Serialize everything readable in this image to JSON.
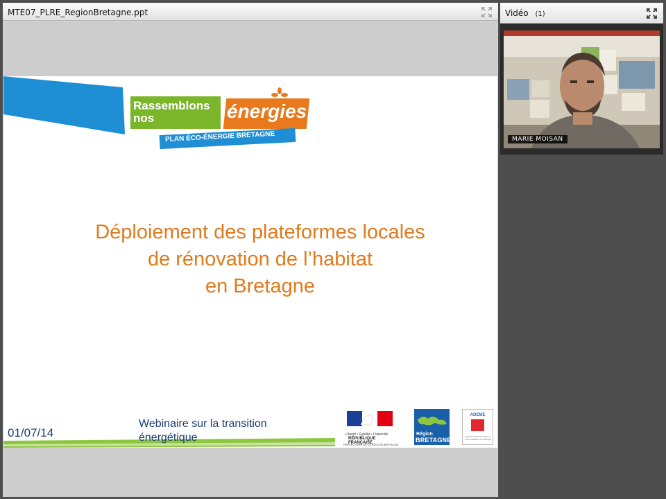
{
  "slide_panel": {
    "title": "MTE07_PLRE_RegionBretagne.ppt",
    "expand_icon": "expand-icon"
  },
  "video_panel": {
    "title": "Vidéo",
    "count": "(1)",
    "participant_name": "MARIE MOISAN",
    "expand_icon": "expand-icon"
  },
  "slide": {
    "logo_text": {
      "rassemblons": "Rassemblons",
      "nos": "nos",
      "energies": "énergies!",
      "plan": "PLAN ÉCO-ÉNERGIE BRETAGNE"
    },
    "title_lines": [
      "Déploiement des plateformes locales",
      "de rénovation de l’habitat",
      "en Bretagne"
    ],
    "date": "01/07/14",
    "webinar_line1": "Webinaire sur la transition",
    "webinar_line2": "énergétique",
    "republique": {
      "motto": "Liberté • Égalité • Fraternité",
      "name": "RÉPUBLIQUE FRANÇAISE",
      "prefecture": "PRÉFECTURE DE LA RÉGION BRETAGNE"
    },
    "region": {
      "line1": "Région",
      "line2": "BRETAGNE"
    },
    "ademe": {
      "name": "ADEME",
      "subtitle": "Agence de l'Environnement et de la Maîtrise de l'Énergie"
    },
    "colors": {
      "title_orange": "#e07a1c",
      "brand_green": "#7ab52a",
      "brand_blue": "#1f8fd5",
      "text_navy": "#1a3d73"
    }
  }
}
